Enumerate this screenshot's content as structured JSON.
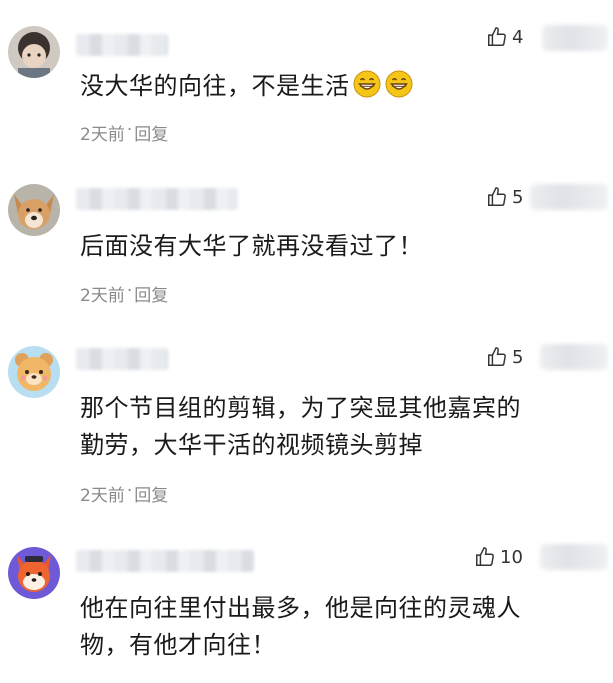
{
  "comments": [
    {
      "text": "没大华的向往，不是生活",
      "emoji_count": 2,
      "emoji_icon": "grinning-face-emoji",
      "likes": "4",
      "time": "2天前",
      "separator": "·",
      "reply_label": "回复"
    },
    {
      "text": "后面没有大华了就再没看过了！",
      "likes": "5",
      "time": "2天前",
      "separator": "·",
      "reply_label": "回复"
    },
    {
      "text_line1": "那个节目组的剪辑，为了突显其他嘉宾的",
      "text_line2": "勤劳，大华干活的视频镜头剪掉",
      "likes": "5",
      "time": "2天前",
      "separator": "·",
      "reply_label": "回复"
    },
    {
      "text_line1": "他在向往里付出最多，他是向往的灵魂人",
      "text_line2": "物，有他才向往！",
      "likes": "10"
    }
  ],
  "icons": {
    "like": "thumbs-up-icon"
  },
  "colors": {
    "text": "#1a1a1a",
    "meta": "#8a8a8a",
    "emoji_fill": "#f5c518"
  }
}
